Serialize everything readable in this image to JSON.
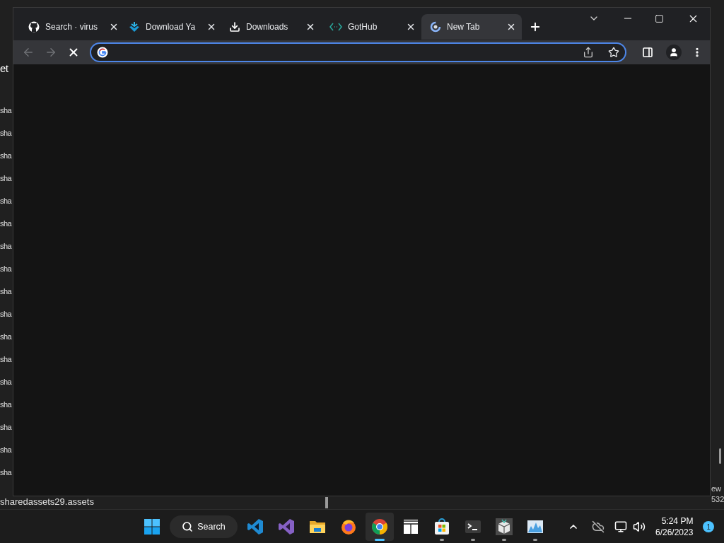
{
  "background_app": {
    "header": "et",
    "rows": [
      "sha",
      "sha",
      "sha",
      "sha",
      "sha",
      "sha",
      "sha",
      "sha",
      "sha",
      "sha",
      "sha",
      "sha",
      "sha",
      "sha",
      "sha",
      "sha",
      "sha"
    ],
    "footer_row": "sharedassets29.assets",
    "right_texts": [
      "ew",
      "532"
    ]
  },
  "browser": {
    "tabs": [
      {
        "title": "Search · virus",
        "kind": "github",
        "selected": false
      },
      {
        "title": "Download Ya",
        "kind": "download-arrow",
        "selected": false
      },
      {
        "title": "Downloads",
        "kind": "download",
        "selected": false
      },
      {
        "title": "GotHub",
        "kind": "code",
        "selected": false
      },
      {
        "title": "New Tab",
        "kind": "loading",
        "selected": true
      }
    ],
    "toolbar": {
      "back_disabled": true,
      "forward_disabled": true,
      "loading": true
    }
  },
  "taskbar": {
    "search": "Search",
    "apps": [
      {
        "kind": "start",
        "running": false,
        "selected": false
      },
      {
        "kind": "vscode",
        "running": false,
        "selected": false
      },
      {
        "kind": "visualstudio",
        "running": false,
        "selected": false
      },
      {
        "kind": "explorer",
        "running": false,
        "selected": false
      },
      {
        "kind": "firefox",
        "running": false,
        "selected": false
      },
      {
        "kind": "chrome",
        "running": true,
        "selected": true
      },
      {
        "kind": "grid",
        "running": false,
        "selected": false
      },
      {
        "kind": "store",
        "running": true,
        "selected": false
      },
      {
        "kind": "terminal",
        "running": true,
        "selected": false
      },
      {
        "kind": "package",
        "running": true,
        "selected": false
      },
      {
        "kind": "monitor",
        "running": true,
        "selected": false
      }
    ],
    "time": "5:24 PM",
    "date": "6/26/2023",
    "notifications": "1"
  }
}
